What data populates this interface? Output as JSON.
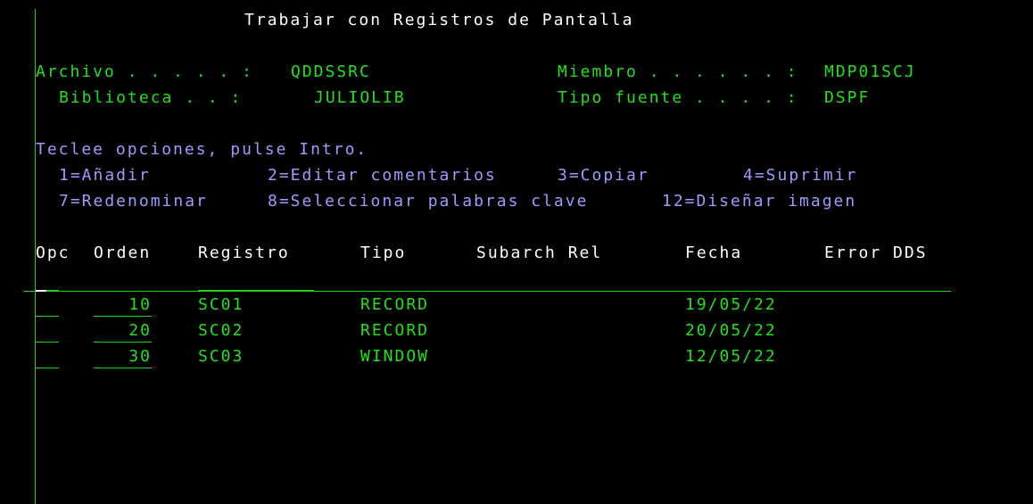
{
  "title": "Trabajar con Registros de Pantalla",
  "header": {
    "archivo_label": "Archivo . . . . . :",
    "archivo_value": "QDDSSRC",
    "biblioteca_label": "Biblioteca . . :",
    "biblioteca_value": "JULIOLIB",
    "miembro_label": "Miembro . . . . . . :",
    "miembro_value": "MDP01SCJ",
    "tipo_fuente_label": "Tipo fuente . . . . :",
    "tipo_fuente_value": "DSPF"
  },
  "instructions": "Teclee opciones, pulse Intro.",
  "options": [
    "1=Añadir",
    "2=Editar comentarios",
    "3=Copiar",
    "4=Suprimir",
    "7=Redenominar",
    "8=Seleccionar palabras clave",
    "12=Diseñar imagen"
  ],
  "columns": [
    "Opc",
    "Orden",
    "Registro",
    "Tipo",
    "Subarch Rel",
    "Fecha",
    "Error DDS"
  ],
  "rows": [
    {
      "opc": "",
      "orden": "10",
      "registro": "SC01",
      "tipo": "RECORD",
      "subarch": "",
      "fecha": "19/05/22",
      "error": ""
    },
    {
      "opc": "",
      "orden": "20",
      "registro": "SC02",
      "tipo": "RECORD",
      "subarch": "",
      "fecha": "20/05/22",
      "error": ""
    },
    {
      "opc": "",
      "orden": "30",
      "registro": "SC03",
      "tipo": "WINDOW",
      "subarch": "",
      "fecha": "12/05/22",
      "error": ""
    }
  ]
}
